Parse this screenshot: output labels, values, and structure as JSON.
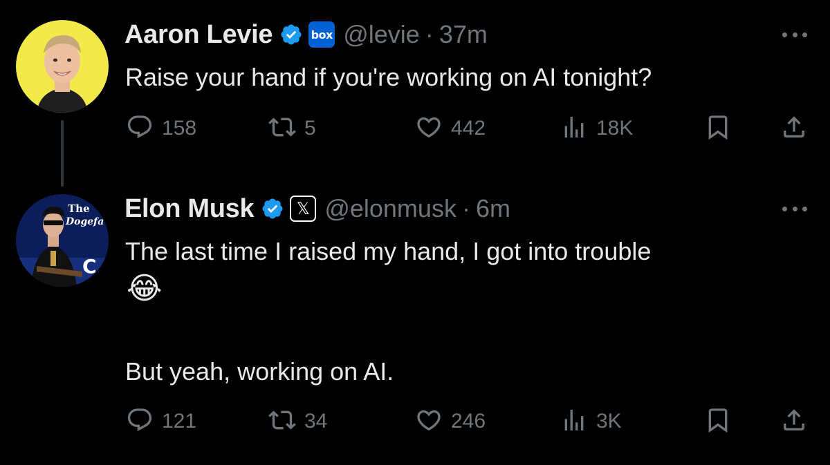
{
  "tweets": [
    {
      "author": {
        "name": "Aaron Levie",
        "handle": "@levie",
        "affiliation_badge": "box",
        "verified": true
      },
      "time": "37m",
      "text_lines": [
        "Raise your hand if you're working on AI tonight?"
      ],
      "stats": {
        "replies": "158",
        "reposts": "5",
        "likes": "442",
        "views": "18K"
      }
    },
    {
      "author": {
        "name": "Elon Musk",
        "handle": "@elonmusk",
        "affiliation_badge": "𝕏",
        "verified": true,
        "avatar_text": [
          "The",
          "Dogefa",
          "C"
        ]
      },
      "time": "6m",
      "text_lines": [
        "The last time I raised my hand, I got into trouble",
        "But yeah, working on AI."
      ],
      "emoji": "😂",
      "stats": {
        "replies": "121",
        "reposts": "34",
        "likes": "246",
        "views": "3K"
      }
    }
  ],
  "separator": "·",
  "icons": {
    "reply": "speech-bubble-icon",
    "repost": "repost-arrows-icon",
    "like": "heart-icon",
    "views": "bar-chart-icon",
    "bookmark": "bookmark-icon",
    "share": "share-upload-icon",
    "more": "more-dots-icon",
    "verified": "verified-check-icon"
  },
  "colors": {
    "background": "#000000",
    "text": "#e7e9ea",
    "secondary": "#71767b",
    "verified": "#1d9bf0",
    "box_brand": "#0061d5",
    "thread_line": "#333639"
  }
}
